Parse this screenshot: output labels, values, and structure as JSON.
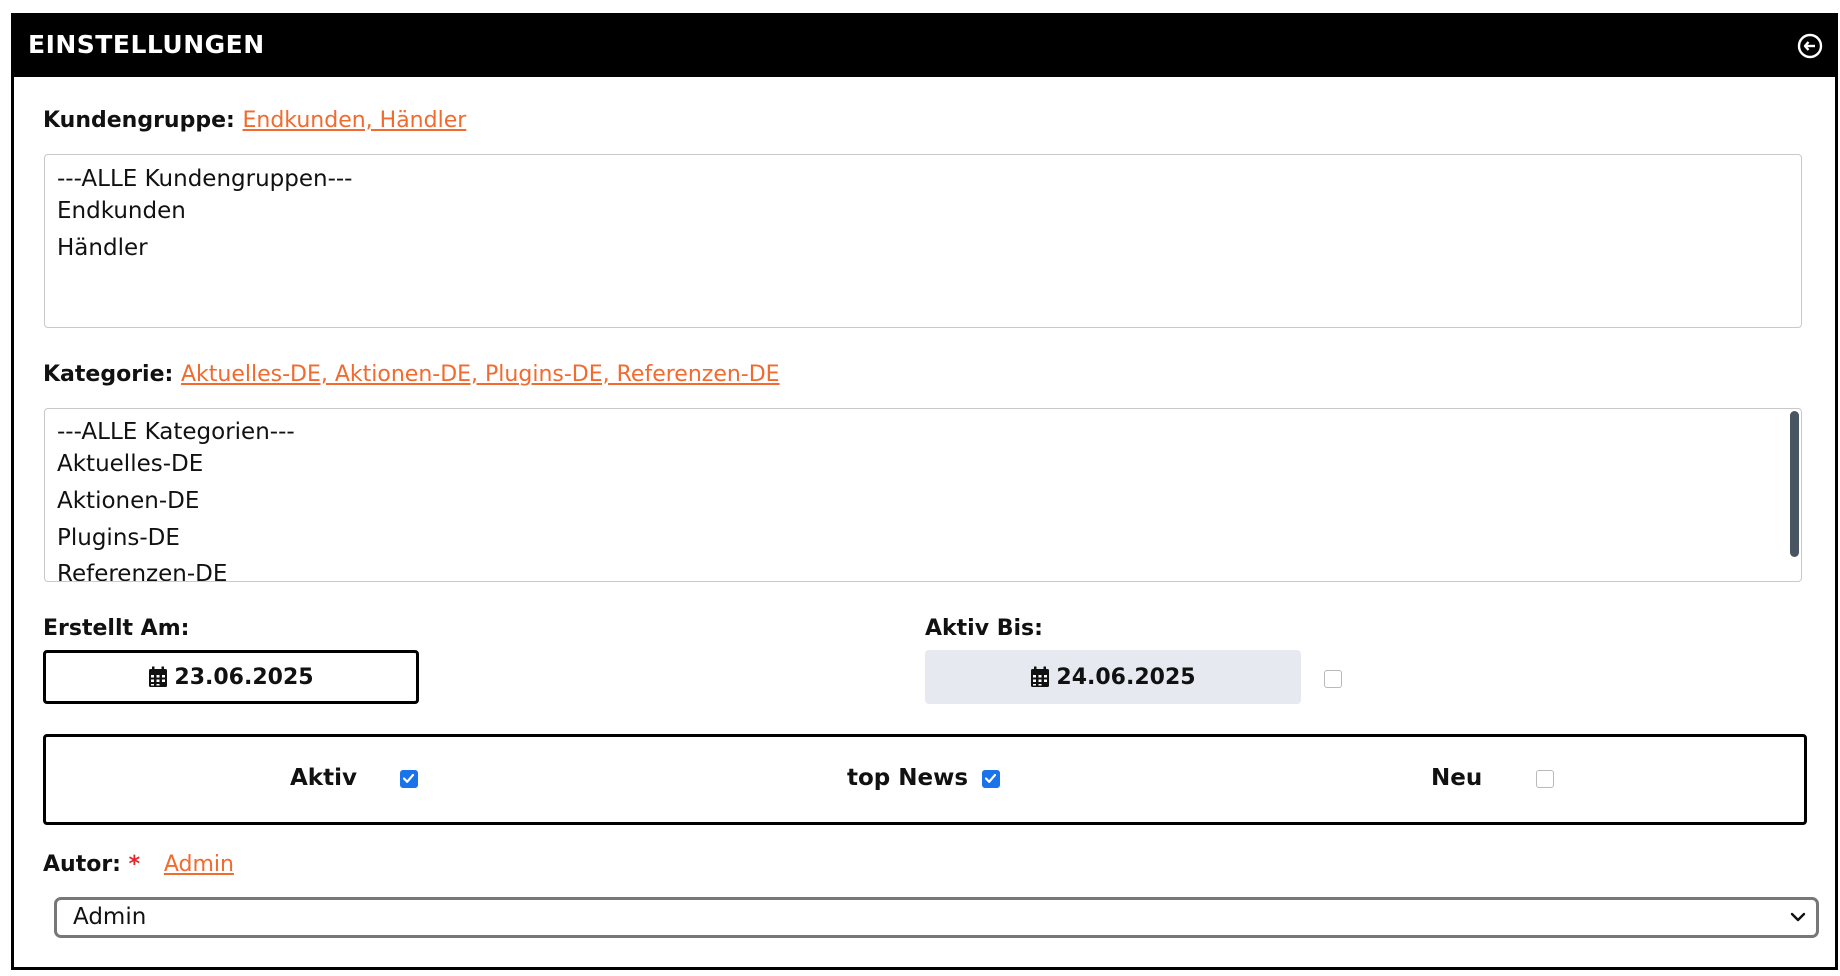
{
  "panel": {
    "title": "EINSTELLUNGEN",
    "collapse_icon": "collapse-circle-icon"
  },
  "customer_group": {
    "label": "Kundengruppe:",
    "selected": "Endkunden, Händler",
    "options": [
      "---ALLE Kundengruppen---",
      "Endkunden",
      "Händler"
    ]
  },
  "category": {
    "label": "Kategorie:",
    "selected": "Aktuelles-DE, Aktionen-DE, Plugins-DE, Referenzen-DE",
    "options": [
      "---ALLE Kategorien---",
      "Aktuelles-DE",
      "Aktionen-DE",
      "Plugins-DE",
      "Referenzen-DE"
    ]
  },
  "created": {
    "label": "Erstellt Am:",
    "value": "23.06.2025",
    "icon": "calendar-icon"
  },
  "active_until": {
    "label": "Aktiv Bis:",
    "value": "24.06.2025",
    "icon": "calendar-icon",
    "enabled_checked": false
  },
  "flags": [
    {
      "label": "Aktiv",
      "checked": true
    },
    {
      "label": "top News",
      "checked": true
    },
    {
      "label": "Neu",
      "checked": false
    }
  ],
  "author": {
    "label": "Autor:",
    "required_mark": "*",
    "link": "Admin",
    "selected": "Admin"
  },
  "colors": {
    "accent": "#f26a2e",
    "checkbox_on": "#1a73e8",
    "header_bg": "#000000",
    "disabled_bg": "#e6eaf0"
  }
}
